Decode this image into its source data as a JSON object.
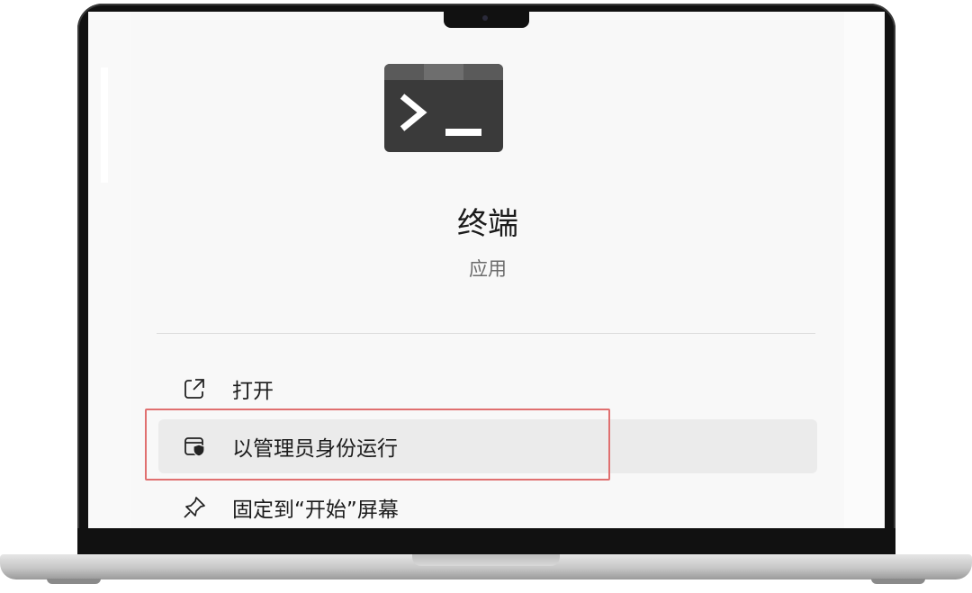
{
  "app": {
    "title": "终端",
    "subtitle": "应用",
    "icon": "terminal-icon"
  },
  "menu": {
    "items": [
      {
        "label": "打开",
        "icon": "open-external-icon"
      },
      {
        "label": "以管理员身份运行",
        "icon": "run-as-admin-shield-icon"
      },
      {
        "label": "固定到“开始”屏幕",
        "icon": "pin-icon"
      }
    ]
  },
  "colors": {
    "highlight_border": "#e07070",
    "highlight_bg": "#ebebeb",
    "terminal_icon_bg": "#3a3a3a"
  }
}
